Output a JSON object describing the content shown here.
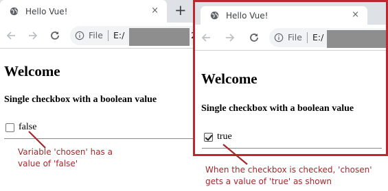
{
  "browser": {
    "tab_title": "Hello Vue!",
    "new_tab_symbol": "+",
    "close_symbol": "×",
    "omnibox": {
      "file_label": "File",
      "url_left": "E:/",
      "url_left_tail": "2",
      "url_right": "E:/"
    }
  },
  "left": {
    "heading": "Welcome",
    "subheading": "Single checkbox with a boolean value",
    "checkbox_label": "false",
    "checked": false
  },
  "right": {
    "heading": "Welcome",
    "subheading": "Single checkbox with a boolean value",
    "checkbox_label": "true",
    "checked": true
  },
  "annotations": {
    "left_line1": "Variable 'chosen' has a",
    "left_line2": "value of 'false'",
    "right_line1": "When the checkbox is checked, 'chosen'",
    "right_line2": "gets a value of 'true' as shown"
  },
  "colors": {
    "annotation": "#a5272b",
    "highlight_border": "#c0272d",
    "tabstrip": "#dee1e6",
    "omnibox": "#f1f3f4",
    "redaction": "#8e8e8e"
  }
}
